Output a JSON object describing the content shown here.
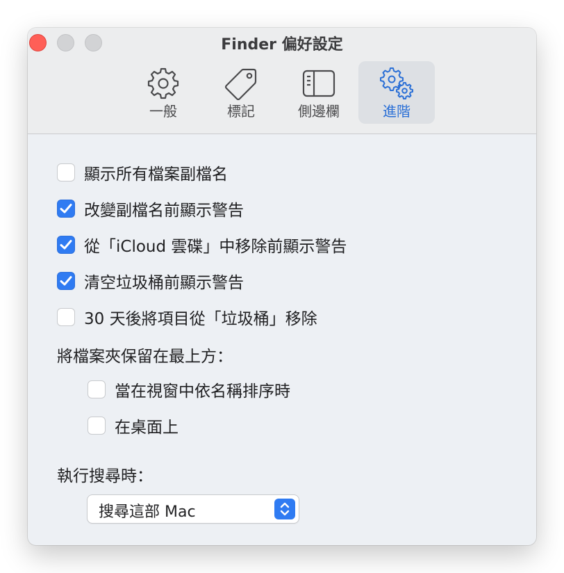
{
  "window": {
    "title": "Finder 偏好設定"
  },
  "toolbar": {
    "tabs": [
      {
        "label": "一般",
        "icon": "gear-icon",
        "selected": false
      },
      {
        "label": "標記",
        "icon": "tag-icon",
        "selected": false
      },
      {
        "label": "側邊欄",
        "icon": "sidebar-icon",
        "selected": false
      },
      {
        "label": "進階",
        "icon": "gears-icon",
        "selected": true
      }
    ]
  },
  "options": [
    {
      "label": "顯示所有檔案副檔名",
      "checked": false
    },
    {
      "label": "改變副檔名前顯示警告",
      "checked": true
    },
    {
      "label": "從「iCloud 雲碟」中移除前顯示警告",
      "checked": true
    },
    {
      "label": "清空垃圾桶前顯示警告",
      "checked": true
    },
    {
      "label": "30 天後將項目從「垃圾桶」移除",
      "checked": false
    }
  ],
  "folders_on_top": {
    "label": "將檔案夾保留在最上方：",
    "options": [
      {
        "label": "當在視窗中依名稱排序時",
        "checked": false
      },
      {
        "label": "在桌面上",
        "checked": false
      }
    ]
  },
  "search": {
    "label": "執行搜尋時：",
    "selected": "搜尋這部 Mac"
  },
  "colors": {
    "accent": "#2f7bf2",
    "close_button": "#ff5f57"
  }
}
